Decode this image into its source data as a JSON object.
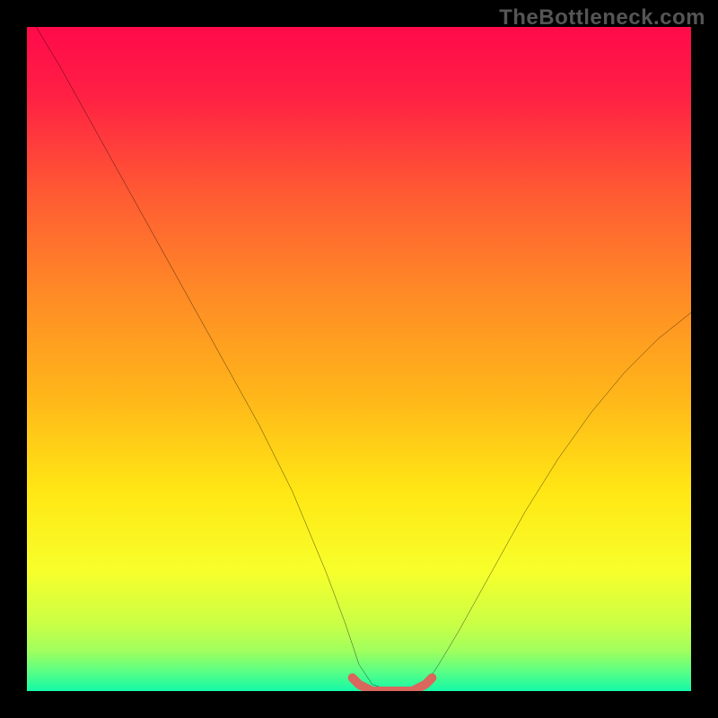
{
  "watermark": "TheBottleneck.com",
  "chart_data": {
    "type": "line",
    "title": "",
    "xlabel": "",
    "ylabel": "",
    "xlim": [
      0,
      100
    ],
    "ylim": [
      0,
      100
    ],
    "grid": false,
    "series": [
      {
        "name": "bottleneck-curve",
        "x": [
          -1,
          5,
          10,
          15,
          20,
          25,
          30,
          35,
          40,
          45,
          48,
          50,
          52,
          55,
          58,
          60,
          62,
          65,
          70,
          75,
          80,
          85,
          90,
          95,
          100
        ],
        "y": [
          104,
          94,
          85,
          76,
          67,
          58,
          49,
          40,
          30,
          18,
          10,
          4,
          1,
          0,
          0,
          1,
          4,
          9,
          18,
          27,
          35,
          42,
          48,
          53,
          57
        ]
      },
      {
        "name": "optimal-zone-marker",
        "x": [
          49,
          50,
          52,
          54,
          56,
          58,
          60,
          61
        ],
        "y": [
          2,
          1,
          0,
          0,
          0,
          0,
          1,
          2
        ]
      }
    ],
    "background_gradient": {
      "type": "vertical",
      "stops": [
        {
          "offset": 0.0,
          "color": "#ff0a4a"
        },
        {
          "offset": 0.1,
          "color": "#ff1f44"
        },
        {
          "offset": 0.25,
          "color": "#ff5a33"
        },
        {
          "offset": 0.4,
          "color": "#ff8a26"
        },
        {
          "offset": 0.55,
          "color": "#ffb41a"
        },
        {
          "offset": 0.7,
          "color": "#ffe714"
        },
        {
          "offset": 0.82,
          "color": "#f7ff2b"
        },
        {
          "offset": 0.9,
          "color": "#c9ff46"
        },
        {
          "offset": 0.94,
          "color": "#9fff5e"
        },
        {
          "offset": 0.97,
          "color": "#5bff84"
        },
        {
          "offset": 1.0,
          "color": "#14f9a7"
        }
      ]
    },
    "marker_color": "#d9675e"
  }
}
